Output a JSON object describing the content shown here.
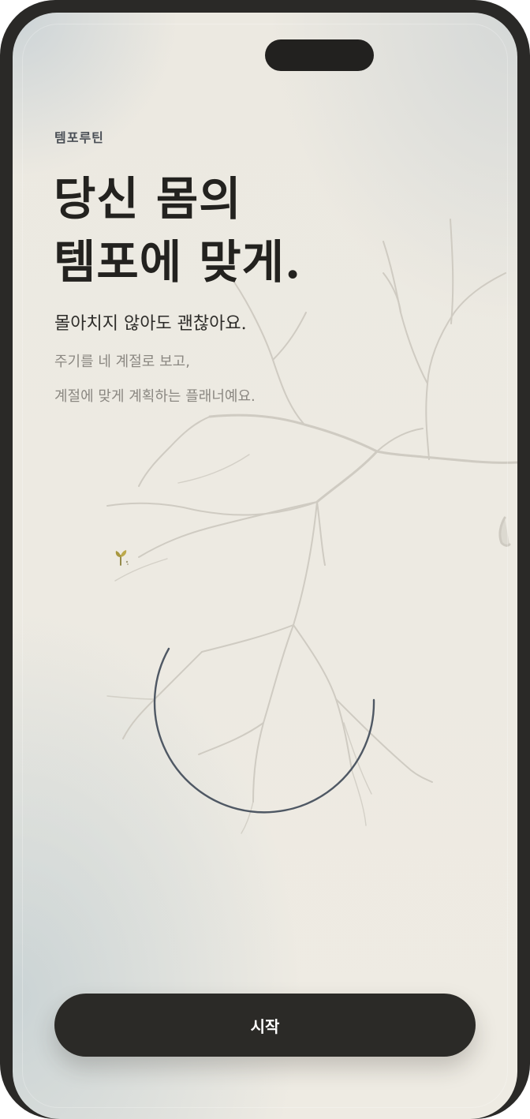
{
  "app": {
    "brand": "템포루틴"
  },
  "hero": {
    "headline_line1": "당신 몸의",
    "headline_line2": "템포에 맞게.",
    "lead": "몰아치지 않아도 괜찮아요.",
    "desc_line1": "주기를 네 계절로 보고,",
    "desc_line2": "계절에 맞게 계획하는 플래너예요."
  },
  "actions": {
    "start_label": "시작"
  },
  "illustration": {
    "tree_icon": "tree-branch-illustration",
    "sprout_icon": "sprout-icon",
    "ring_icon": "cycle-ring-icon"
  },
  "colors": {
    "frame": "#2a2927",
    "background": "#ece9e1",
    "headline": "#23221f",
    "muted_text": "#8b8882",
    "ring": "#4f5864",
    "button": "#2b2a27",
    "button_text": "#ffffff"
  }
}
